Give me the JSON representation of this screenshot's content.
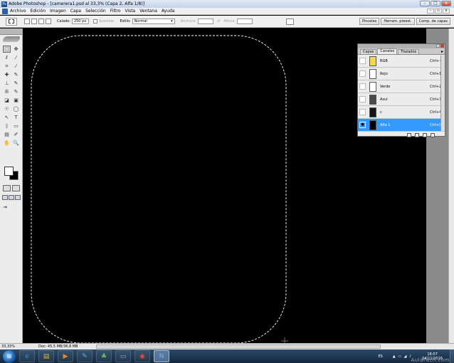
{
  "window": {
    "title": "Adobe Photoshop - [camerera1.psd al 33,3% (Capa 2, Alfa 1/8)]",
    "app_icon": "Ps",
    "buttons": {
      "minimize": "–",
      "maximize": "□",
      "close": "x"
    }
  },
  "menubar": {
    "items": [
      "Archivo",
      "Edición",
      "Imagen",
      "Capa",
      "Selección",
      "Filtro",
      "Vista",
      "Ventana",
      "Ayuda"
    ],
    "doc_buttons": {
      "minimize": "–",
      "restore": "▫",
      "close": "x"
    }
  },
  "options": {
    "feather_label": "Calado:",
    "feather_value": "250 px",
    "antialias_label": "Suavizar",
    "style_label": "Estilo:",
    "style_value": "Normal",
    "width_label": "Anchura:",
    "height_label": "Altura:",
    "swap_glyph": "⇄",
    "dropdown_glyph": "▾",
    "palette_tabs": [
      "Pinceles",
      "Herram. preest.",
      "Comp. de capas"
    ]
  },
  "tools": {
    "glyphs": [
      "⬚",
      "✥",
      "ℓ",
      "⁄",
      "⌗",
      "⁄",
      "✚",
      "✎",
      "⊥",
      "✎",
      "✇",
      "✎",
      "◪",
      "▣",
      "☉",
      "◯",
      "↖",
      "T",
      "◊",
      "▭",
      "▤",
      "✐",
      "✋",
      "🔍"
    ],
    "jump_glyph": "⇥"
  },
  "channels_panel": {
    "tabs": [
      "Capas",
      "Canales",
      "Trazados"
    ],
    "active_tab": "Canales",
    "menu_glyph": "▸",
    "channels": [
      {
        "name": "RGB",
        "shortcut": "Ctrl+~",
        "thumb": "#f5d84a",
        "visible": "",
        "active": false
      },
      {
        "name": "Rojo",
        "shortcut": "Ctrl+1",
        "thumb": "#ffffff",
        "visible": "",
        "active": false
      },
      {
        "name": "Verde",
        "shortcut": "Ctrl+2",
        "thumb": "#ffffff",
        "visible": "",
        "active": false
      },
      {
        "name": "Azul",
        "shortcut": "Ctrl+3",
        "thumb": "#4a4a4a",
        "visible": "",
        "active": false
      },
      {
        "name": "c",
        "shortcut": "Ctrl+4",
        "thumb": "#151515",
        "visible": "",
        "active": false
      },
      {
        "name": "Alfa 1",
        "shortcut": "Ctrl+5",
        "thumb": "#000000",
        "visible": "●",
        "active": true
      }
    ]
  },
  "status": {
    "zoom": "33,33%",
    "doc_info": "Doc: 45,5 MB/36,8 MB",
    "arrow": "▶"
  },
  "taskbar": {
    "start_glyph": "⊞",
    "apps": [
      {
        "name": "ie",
        "glyph": "e",
        "color": "#3f8fd8",
        "active": false
      },
      {
        "name": "explorer",
        "glyph": "▤",
        "color": "#e0b54a",
        "active": false
      },
      {
        "name": "media",
        "glyph": "▶",
        "color": "#e88a2a",
        "active": false
      },
      {
        "name": "paint",
        "glyph": "✎",
        "color": "#5ab0e8",
        "active": false
      },
      {
        "name": "games",
        "glyph": "♣",
        "color": "#6cbf5c",
        "active": false
      },
      {
        "name": "scanner",
        "glyph": "▭",
        "color": "#9ab0c8",
        "active": false
      },
      {
        "name": "chrome",
        "glyph": "◉",
        "color": "#e14b3a",
        "active": false
      },
      {
        "name": "photoshop",
        "glyph": "N",
        "color": "#7ab0ea",
        "active": true
      }
    ],
    "language": "ES",
    "tray_icons": "▲ ▭ ◢ ♪",
    "time": "18:07",
    "date": "04/11/2016"
  },
  "watermark": "AulaFacil.com",
  "colors": {
    "canvas": "#000000",
    "selection_marquee": "#ffffff",
    "active_channel": "#3399ff"
  }
}
